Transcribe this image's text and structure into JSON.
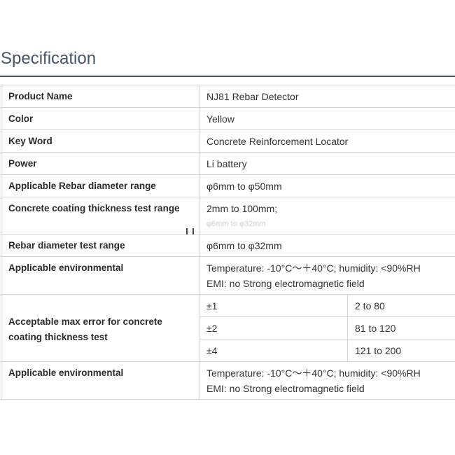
{
  "page": {
    "title": "Specification"
  },
  "spec": {
    "product_name": {
      "label": "Product Name",
      "value": "NJ81 Rebar Detector"
    },
    "color": {
      "label": "Color",
      "value": "Yellow"
    },
    "key_word": {
      "label": "Key Word",
      "value": "Concrete Reinforcement Locator"
    },
    "power": {
      "label": "Power",
      "value": "Li battery"
    },
    "rebar_range": {
      "label": "Applicable Rebar diameter range",
      "value": "φ6mm to φ50mm"
    },
    "coating_range": {
      "label": "Concrete coating thickness test range",
      "value": "2mm to 100mm;",
      "faded": "φ6mm to φ32mm"
    },
    "rebar_test": {
      "label": "Rebar diameter test range",
      "value": "φ6mm to φ32mm"
    },
    "env1": {
      "label": "Applicable environmental",
      "line1": "Temperature: -10°C～＋40°C; humidity: <90%RH",
      "line2": "EMI: no Strong electromagnetic field"
    },
    "error": {
      "label": "Acceptable max error for concrete coating thickness test",
      "rows": [
        {
          "error": "±1",
          "range": "2 to 80"
        },
        {
          "error": "±2",
          "range": "81 to 120"
        },
        {
          "error": "±4",
          "range": "121 to 200"
        }
      ]
    },
    "env2": {
      "label": "Applicable environmental",
      "line1": "Temperature: -10°C～＋40°C; humidity: <90%RH",
      "line2": "EMI: no Strong electromagnetic field"
    }
  }
}
